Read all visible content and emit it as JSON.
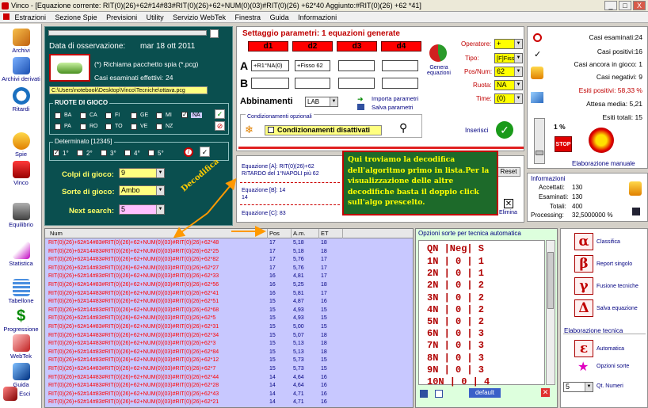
{
  "window": {
    "title": "Vinco - [Equazione corrente: RIT(0)(26)+62#14#83#RIT(0)(26)+62+NUM(0)(03)#RIT(0)(26) +62*40 Aggiunto:#RIT(0)(26) +62 *41]",
    "min": "_",
    "max": "□",
    "close": "X"
  },
  "menu": [
    "Estrazioni",
    "Sezione Spie",
    "Previsioni",
    "Utility",
    "Servizio WebTek",
    "Finestra",
    "Guida",
    "Informazioni"
  ],
  "sidebar": [
    "Archivi",
    "Archivi derivati",
    "Ritardi",
    "Spie",
    "Vinco",
    "Equilibrio",
    "Statistica",
    "Tabellone",
    "Progressione",
    "WebTek",
    "Guida",
    "Esci"
  ],
  "left": {
    "obs_label": "Data di osservazione:",
    "obs_date": "mar 18 ott 2011",
    "pack_text": "(*) Richiama pacchetto spia (*.pcg)",
    "cases_label": "Casi esaminati effettivi:",
    "cases_value": "24",
    "path": "C:\\Users\\notebook\\Desktop\\Vinco\\Tecniche\\ottava.pcg",
    "ruote_title": "RUOTE DI GIOCO",
    "ruote_row1": [
      "BA",
      "CA",
      "FI",
      "GE",
      "MI",
      "NA"
    ],
    "ruote_row2": [
      "PA",
      "RO",
      "TO",
      "VE",
      "NZ"
    ],
    "det_title": "Determinato [12345]",
    "det_items": [
      "1°",
      "2°",
      "3°",
      "4°",
      "5°"
    ],
    "colpi_label": "Colpi di gioco:",
    "colpi_value": "9",
    "sorte_label": "Sorte di gioco:",
    "sorte_value": "Ambo",
    "next_label": "Next search:",
    "next_value": "5"
  },
  "params": {
    "title": "Settaggio parametri: 1 equazioni generate",
    "d": [
      "d1",
      "d2",
      "d3",
      "d4"
    ],
    "rowA": "A",
    "rowB": "B",
    "a1": "+R1°NA(0)",
    "a2": "+Fisso 62",
    "genera": "Genera equazioni",
    "abbinamenti": "Abbinamenti",
    "lab": "LAB",
    "importa": "Importa parametri",
    "salva": "Salva parametri",
    "cond_title": "Condizionamenti opzionali",
    "cond_text": "Condizionamenti disattivati",
    "inserisci": "Inserisci",
    "operatore_label": "Operatore:",
    "operatore_value": "+",
    "tipo_label": "Tipo:",
    "tipo_value": "[F]Fisso",
    "posnum_label": "Pos/Num:",
    "posnum_value": "62",
    "ruota_label": "Ruota:",
    "ruota_value": "NA",
    "tempo_label": "Time:",
    "tempo_value": "(0)"
  },
  "stats": {
    "esaminati": "Casi esaminati:24",
    "positivi": "Casi positivi:16",
    "ancora": "Casi ancora in gioco: 1",
    "negativi": "Casi negativi: 9",
    "esiti": "Esiti positivi: 58,33 %",
    "attesa": "Attesa media: 5,21",
    "esiti_tot": "Esiti totali: 15",
    "pct": "1 %",
    "elab": "Elaborazione manuale",
    "stop": "STOP"
  },
  "info": {
    "title": "Informazioni",
    "accettati_l": "Accettati:",
    "accettati_v": "130",
    "esaminati_l": "Esaminati:",
    "esaminati_v": "130",
    "totali_l": "Totali:",
    "totali_v": "400",
    "processing_l": "Processing:",
    "processing_v": "32,5000000 %"
  },
  "eq": {
    "a1": "Equazione [A]: RIT(0)(26)+62",
    "a2": "RITARDO del 1°NAPOLI  più 62",
    "b1": "Equazione [B]: 14",
    "b2": "14",
    "c1": "Equazione [C]: 83",
    "reset": "Reset",
    "elimina": "Elimina"
  },
  "callout": "Qui troviamo la decodifica dell'algoritmo primo in lista.Per la visualizzazione delle altre decodifiche basta il doppio click sull'algo prescelto.",
  "decodifica": "Decodifica",
  "table": {
    "headers": [
      "Num",
      "Pos",
      "A.m.",
      "ET"
    ],
    "rows": [
      [
        "RIT(0)(26)+62#14#83#RIT(0)(26)+62+NUM(0)(03)#RIT(0)(26)+62*48",
        "17",
        "5,18",
        "18"
      ],
      [
        "RIT(0)(26)+62#14#83#RIT(0)(26)+62+NUM(0)(03)#RIT(0)(26)+62*25",
        "17",
        "5,18",
        "18"
      ],
      [
        "RIT(0)(26)+62#14#83#RIT(0)(26)+62+NUM(0)(03)#RIT(0)(26)+62*82",
        "17",
        "5,76",
        "17"
      ],
      [
        "RIT(0)(26)+62#14#83#RIT(0)(26)+62+NUM(0)(03)#RIT(0)(26)+62*27",
        "17",
        "5,76",
        "17"
      ],
      [
        "RIT(0)(26)+62#14#83#RIT(0)(26)+62+NUM(0)(03)#RIT(0)(26)+62*33",
        "16",
        "4,81",
        "17"
      ],
      [
        "RIT(0)(26)+62#14#83#RIT(0)(26)+62+NUM(0)(03)#RIT(0)(26)+62*56",
        "16",
        "5,25",
        "18"
      ],
      [
        "RIT(0)(26)+62#14#83#RIT(0)(26)+62+NUM(0)(03)#RIT(0)(26)+62*41",
        "16",
        "5,81",
        "17"
      ],
      [
        "RIT(0)(26)+62#14#83#RIT(0)(26)+62+NUM(0)(03)#RIT(0)(26)+62*51",
        "15",
        "4,87",
        "16"
      ],
      [
        "RIT(0)(26)+62#14#83#RIT(0)(26)+62+NUM(0)(03)#RIT(0)(26)+62*68",
        "15",
        "4,93",
        "15"
      ],
      [
        "RIT(0)(26)+62#14#83#RIT(0)(26)+62+NUM(0)(03)#RIT(0)(26)+62*5",
        "15",
        "4,93",
        "15"
      ],
      [
        "RIT(0)(26)+62#14#83#RIT(0)(26)+62+NUM(0)(03)#RIT(0)(26)+62*31",
        "15",
        "5,00",
        "15"
      ],
      [
        "RIT(0)(26)+62#14#83#RIT(0)(26)+62+NUM(0)(03)#RIT(0)(26)+62*34",
        "15",
        "5,07",
        "18"
      ],
      [
        "RIT(0)(26)+62#14#83#RIT(0)(26)+62+NUM(0)(03)#RIT(0)(26)+62*3",
        "15",
        "5,13",
        "18"
      ],
      [
        "RIT(0)(26)+62#14#83#RIT(0)(26)+62+NUM(0)(03)#RIT(0)(26)+62*84",
        "15",
        "5,13",
        "18"
      ],
      [
        "RIT(0)(26)+62#14#83#RIT(0)(26)+62+NUM(0)(03)#RIT(0)(26)+62*12",
        "15",
        "5,73",
        "15"
      ],
      [
        "RIT(0)(26)+62#14#83#RIT(0)(26)+62+NUM(0)(03)#RIT(0)(26)+62*7",
        "15",
        "5,73",
        "15"
      ],
      [
        "RIT(0)(26)+62#14#83#RIT(0)(26)+62+NUM(0)(03)#RIT(0)(26)+62*44",
        "14",
        "4,64",
        "16"
      ],
      [
        "RIT(0)(26)+62#14#83#RIT(0)(26)+62+NUM(0)(03)#RIT(0)(26)+62*28",
        "14",
        "4,64",
        "16"
      ],
      [
        "RIT(0)(26)+62#14#83#RIT(0)(26)+62+NUM(0)(03)#RIT(0)(26)+62*43",
        "14",
        "4,71",
        "16"
      ],
      [
        "RIT(0)(26)+62#14#83#RIT(0)(26)+62+NUM(0)(03)#RIT(0)(26)+62*21",
        "14",
        "4,71",
        "16"
      ]
    ]
  },
  "sorte": {
    "title": "Opzioni sorte per tecnica automatica",
    "header": "QN |Neg| S",
    "rows": [
      "1N | 0 | 1",
      "2N | 0 | 1",
      "2N | 0 | 2",
      "3N | 0 | 2",
      "4N | 0 | 2",
      "5N | 0 | 2",
      "6N | 0 | 3",
      "7N | 0 | 3",
      "8N | 0 | 3",
      "9N | 0 | 3",
      "10N | 0 | 4"
    ],
    "default": "default"
  },
  "rbot": {
    "items": [
      {
        "g": "α",
        "l": "Classifica"
      },
      {
        "g": "β",
        "l": "Report singolo"
      },
      {
        "g": "γ",
        "l": "Fusione tecniche"
      },
      {
        "g": "Δ",
        "l": "Salva equazione"
      }
    ],
    "elab_title": "Elaborazione tecnica",
    "auto": "Automatica",
    "opzioni": "Opzioni sorte",
    "qt_value": "5",
    "qt_label": "Qt. Numeri"
  }
}
